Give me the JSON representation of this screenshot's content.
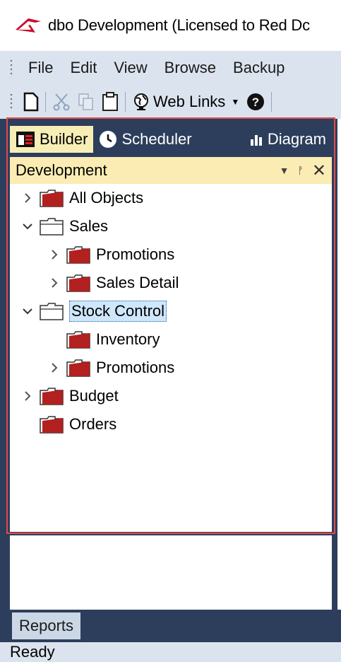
{
  "window": {
    "title": "dbo  Development  (Licensed to Red Dc",
    "logo_icon": "redshift-logo-icon"
  },
  "menu": {
    "items": [
      "File",
      "Edit",
      "View",
      "Browse",
      "Backup"
    ]
  },
  "toolbar": {
    "new_icon": "new-document-icon",
    "cut_icon": "scissors-icon",
    "copy_icon": "copy-icon",
    "paste_icon": "clipboard-icon",
    "web_links_icon": "globe-icon",
    "web_links_label": "Web Links",
    "help_icon": "help-icon"
  },
  "tabs": {
    "builder": "Builder",
    "scheduler": "Scheduler",
    "diagram": "Diagram"
  },
  "panel": {
    "title": "Development"
  },
  "tree": {
    "nodes": [
      {
        "label": "All Objects",
        "expander": "collapsed",
        "folder": "red"
      },
      {
        "label": "Sales",
        "expander": "expanded",
        "folder": "gray"
      },
      {
        "label": "Promotions",
        "expander": "collapsed",
        "folder": "red"
      },
      {
        "label": "Sales Detail",
        "expander": "collapsed",
        "folder": "red"
      },
      {
        "label": "Stock Control",
        "expander": "expanded",
        "folder": "gray",
        "selected": true
      },
      {
        "label": "Inventory",
        "expander": "none",
        "folder": "red"
      },
      {
        "label": "Promotions",
        "expander": "collapsed",
        "folder": "red"
      },
      {
        "label": "Budget",
        "expander": "collapsed",
        "folder": "red"
      },
      {
        "label": "Orders",
        "expander": "none",
        "folder": "red"
      }
    ]
  },
  "bottom": {
    "reports_tab": "Reports"
  },
  "status": {
    "text": "Ready"
  },
  "colors": {
    "frame": "#2d3e5c",
    "chrome": "#dbe3ee",
    "panel_header": "#fbecb3",
    "highlight_border": "#e04a4a",
    "selection": "#cfe7fb",
    "folder_red": "#b2201f"
  }
}
